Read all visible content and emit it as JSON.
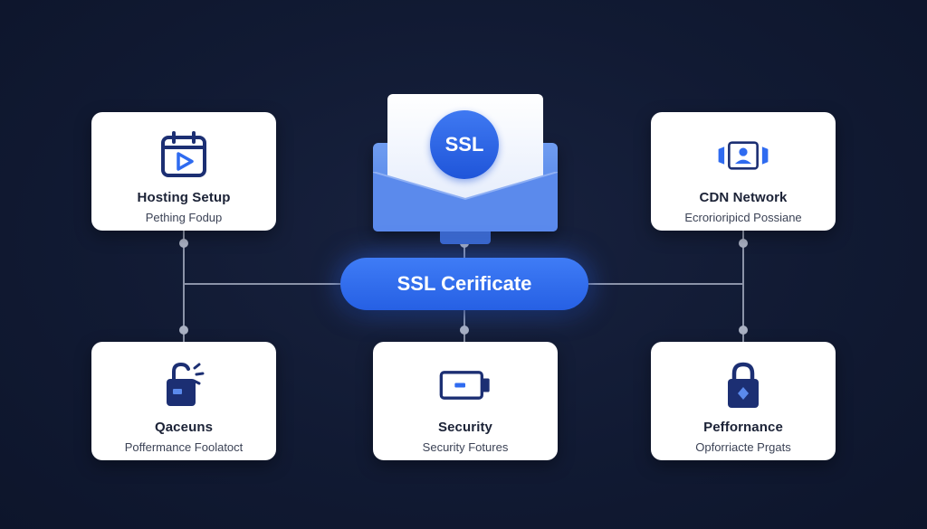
{
  "diagram": {
    "center": {
      "badge_label": "SSL",
      "pill_label": "SSL Cerificate"
    },
    "cards": {
      "hosting": {
        "title": "Hosting Setup",
        "subtitle": "Pething Fodup",
        "icon": "calendar-play-icon"
      },
      "cdn": {
        "title": "CDN Network",
        "subtitle": "Ecrorioripicd Possiane",
        "icon": "user-profile-icon"
      },
      "qaceuns": {
        "title": "Qaceuns",
        "subtitle": "Poffermance Foolatoct",
        "icon": "unlocked-padlock-icon"
      },
      "security": {
        "title": "Security",
        "subtitle": "Security Fotures",
        "icon": "battery-icon"
      },
      "performance": {
        "title": "Peffornance",
        "subtitle": "Opforriacte Prgats",
        "icon": "padlock-icon"
      }
    },
    "colors": {
      "background": "#111a33",
      "accent": "#2f6bf0",
      "icon": "#1c2f73",
      "connector": "#8b93a8"
    }
  }
}
